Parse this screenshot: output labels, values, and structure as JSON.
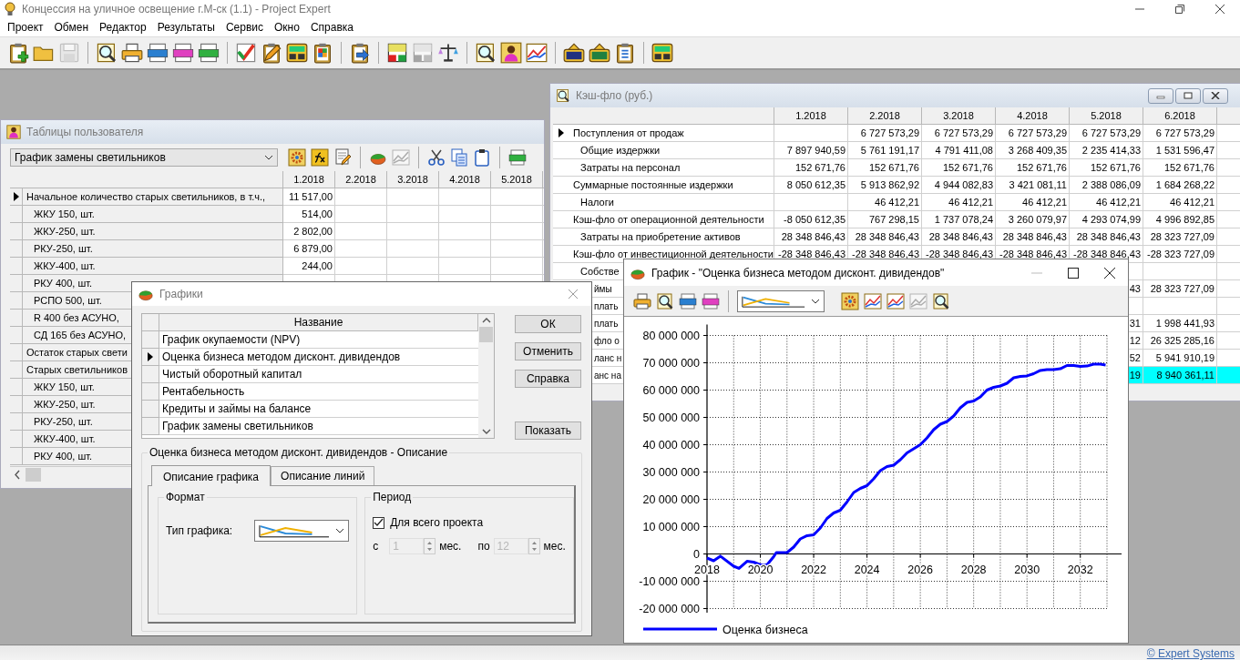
{
  "window": {
    "title": "Концессия на уличное освещение г.М-ск (1.1) - Project Expert"
  },
  "menu": [
    "Проект",
    "Обмен",
    "Редактор",
    "Результаты",
    "Сервис",
    "Окно",
    "Справка"
  ],
  "toolbar": [
    [
      {
        "disabled": false
      },
      {
        "disabled": false
      },
      {
        "disabled": true
      }
    ],
    [
      {
        "disabled": false
      },
      {
        "disabled": false
      },
      {
        "disabled": false
      },
      {
        "disabled": false
      },
      {
        "disabled": false
      }
    ],
    [
      {
        "disabled": false
      },
      {
        "disabled": false
      },
      {
        "disabled": false
      },
      {
        "disabled": false
      }
    ],
    [
      {
        "disabled": false
      }
    ],
    [
      {
        "disabled": false
      },
      {
        "disabled": true
      },
      {
        "disabled": false
      }
    ],
    [
      {
        "disabled": false
      },
      {
        "disabled": false
      },
      {
        "disabled": false
      }
    ],
    [
      {
        "disabled": false
      },
      {
        "disabled": false
      },
      {
        "disabled": false
      }
    ],
    [
      {
        "disabled": false
      }
    ]
  ],
  "user_tables": {
    "title": "Таблицы пользователя",
    "table_select": "График замены светильников",
    "toolbar": [
      [
        {
          "disabled": false
        },
        {
          "disabled": false
        },
        {
          "disabled": false
        }
      ],
      [
        {
          "disabled": false
        },
        {
          "disabled": true
        }
      ],
      [
        {
          "disabled": false
        },
        {
          "disabled": false
        },
        {
          "disabled": false
        }
      ],
      [
        {
          "disabled": false
        }
      ]
    ],
    "columns": [
      "1.2018",
      "2.2018",
      "3.2018",
      "4.2018",
      "5.2018"
    ],
    "rows": [
      {
        "label": "Начальное количество старых светильников, в т.ч.,",
        "selected": true,
        "values": [
          "11 517,00"
        ],
        "children": [
          {
            "label": "ЖКУ 150, шт.",
            "selected": false,
            "values": [
              "514,00"
            ]
          },
          {
            "label": "ЖКУ-250, шт.",
            "selected": false,
            "values": [
              "2 802,00"
            ]
          },
          {
            "label": "РКУ-250, шт.",
            "selected": false,
            "values": [
              "6 879,00"
            ]
          },
          {
            "label": "ЖКУ-400, шт.",
            "selected": false,
            "values": [
              "244,00"
            ]
          },
          {
            "label": "РКУ 400, шт.",
            "selected": false
          },
          {
            "label": "РСПО 500, шт.",
            "selected": false
          },
          {
            "label": "R 400 без АСУНО,",
            "selected": false
          },
          {
            "label": "СД 165 без АСУНО,",
            "selected": false
          }
        ]
      },
      {
        "label": "Остаток старых свети",
        "selected": false
      },
      {
        "label": "Старых светильников",
        "selected": false,
        "children": [
          {
            "label": "ЖКУ 150, шт.",
            "selected": false
          },
          {
            "label": "ЖКУ-250, шт.",
            "selected": false
          },
          {
            "label": "РКУ-250, шт.",
            "selected": false
          },
          {
            "label": "ЖКУ-400, шт.",
            "selected": false
          },
          {
            "label": "РКУ 400, шт.",
            "selected": false
          }
        ]
      }
    ]
  },
  "cash_flow": {
    "title": "Кэш-фло (руб.)",
    "columns": [
      "1.2018",
      "2.2018",
      "3.2018",
      "4.2018",
      "5.2018",
      "6.2018"
    ],
    "rows": [
      {
        "label": "Поступления от продаж",
        "selected": true,
        "values": [
          "6 727 573,29",
          "6 727 573,29",
          "6 727 573,29",
          "6 727 573,29",
          "6 727 573,29"
        ],
        "children": [
          {
            "label": "Общие издержки",
            "selected": false,
            "values": [
              "7 897 940,59",
              "5 761 191,17",
              "4 791 411,08",
              "3 268 409,35",
              "2 235 414,33",
              "1 531 596,47"
            ]
          },
          {
            "label": "Затраты на персонал",
            "selected": false,
            "values": [
              "152 671,76",
              "152 671,76",
              "152 671,76",
              "152 671,76",
              "152 671,76",
              "152 671,76"
            ]
          }
        ]
      },
      {
        "label": "Суммарные постоянные издержки",
        "selected": false,
        "values": [
          "8 050 612,35",
          "5 913 862,92",
          "4 944 082,83",
          "3 421 081,11",
          "2 388 086,09",
          "1 684 268,22"
        ],
        "children": [
          {
            "label": "Налоги",
            "selected": false,
            "values": [
              "46 412,21",
              "46 412,21",
              "46 412,21",
              "46 412,21",
              "46 412,21"
            ]
          }
        ]
      },
      {
        "label": "Кэш-фло от операционной деятельности",
        "selected": false,
        "values": [
          "-8 050 612,35",
          "767 298,15",
          "1 737 078,24",
          "3 260 079,97",
          "4 293 074,99",
          "4 996 892,85"
        ],
        "children": [
          {
            "label": "Затраты на приобретение активов",
            "selected": false,
            "values": [
              "28 348 846,43",
              "28 348 846,43",
              "28 348 846,43",
              "28 348 846,43",
              "28 348 846,43",
              "28 323 727,09"
            ]
          }
        ]
      },
      {
        "label": "Кэш-фло от инвестиционной деятельности",
        "selected": false,
        "values": [
          "-28 348 846,43",
          "-28 348 846,43",
          "-28 348 846,43",
          "-28 348 846,43",
          "-28 348 846,43",
          "-28 323 727,09"
        ],
        "children": [
          {
            "label": "Собстве",
            "selected": false
          }
        ]
      },
      {
        "label": "ймы",
        "kind": "tail",
        "values": [
          "43",
          "28 323 727,09"
        ]
      },
      {
        "label": "плать",
        "kind": "tail"
      },
      {
        "label": "плать",
        "kind": "tail",
        "values": [
          "31",
          "1 998 441,93"
        ]
      },
      {
        "label": "фло о",
        "kind": "tail",
        "values": [
          "12",
          "26 325 285,16"
        ]
      },
      {
        "label": "ланс н",
        "kind": "tail",
        "values": [
          "52",
          "5 941 910,19"
        ]
      },
      {
        "label": "анс на",
        "kind": "tail",
        "highlighted": true,
        "values": [
          "19",
          "8 940 361,11"
        ]
      }
    ]
  },
  "charts_dialog": {
    "title": "Графики",
    "column": "Название",
    "items": [
      {
        "label": "График окупаемости (NPV)",
        "selected": false
      },
      {
        "label": "Оценка бизнеса методом дисконт. дивидендов",
        "selected": true
      },
      {
        "label": "Чистый оборотный капитал",
        "selected": false
      },
      {
        "label": "Рентабельность",
        "selected": false
      },
      {
        "label": "Кредиты и займы на балансе",
        "selected": false
      },
      {
        "label": "График замены светильников",
        "selected": false
      }
    ],
    "buttons": [
      "ОК",
      "Отменить",
      "Справка",
      "Показать"
    ],
    "description": {
      "title": "Оценка бизнеса методом дисконт. дивидендов - Описание",
      "tabs": [
        {
          "label": "Описание графика",
          "selected": true
        },
        {
          "label": "Описание линий",
          "selected": false
        }
      ],
      "format": {
        "title": "Формат",
        "chart_type_label": "Тип графика:"
      },
      "period": {
        "title": "Период",
        "whole_project": {
          "label": "Для всего проекта",
          "checked": true
        },
        "from_label": "с",
        "from": {
          "value": "1",
          "disabled": true
        },
        "from_unit": "мес.",
        "to_label": "по",
        "to": {
          "value": "12",
          "disabled": true
        },
        "to_unit": "мес."
      }
    }
  },
  "chart_window": {
    "title": "График - \"Оценка бизнеса методом дисконт. дивидендов\"",
    "toolbar": [
      [
        {
          "disabled": false
        },
        {
          "disabled": false
        },
        {
          "disabled": false
        },
        {
          "disabled": false
        }
      ],
      [
        {
          "disabled": false
        },
        {
          "disabled": false
        },
        {
          "disabled": false
        },
        {
          "disabled": true
        },
        {
          "disabled": false
        }
      ]
    ],
    "chart_data": {
      "type": "line",
      "grid": true,
      "xlim": [
        2018,
        2033
      ],
      "ylim": [
        -21500000,
        84000000
      ],
      "xticks": [
        2018,
        2020,
        2022,
        2024,
        2026,
        2028,
        2030,
        2032
      ],
      "yticks": [
        {
          "value": 80000000,
          "label": "80 000 000"
        },
        {
          "value": 70000000,
          "label": "70 000 000"
        },
        {
          "value": 60000000,
          "label": "60 000 000"
        },
        {
          "value": 50000000,
          "label": "50 000 000"
        },
        {
          "value": 40000000,
          "label": "40 000 000"
        },
        {
          "value": 30000000,
          "label": "30 000 000"
        },
        {
          "value": 20000000,
          "label": "20 000 000"
        },
        {
          "value": 10000000,
          "label": "10 000 000"
        },
        {
          "value": 0,
          "label": "0"
        },
        {
          "value": -10000000,
          "label": "-10 000 000"
        },
        {
          "value": -20000000,
          "label": "-20 000 000"
        }
      ],
      "x": [
        2018,
        2018.25,
        2018.5,
        2019,
        2019.2,
        2019.5,
        2019.75,
        2020,
        2020.25,
        2020.5,
        2020.6,
        2021,
        2021.25,
        2021.5,
        2021.75,
        2022,
        2022.25,
        2022.5,
        2022.75,
        2023,
        2023.25,
        2023.5,
        2023.75,
        2024,
        2024.25,
        2024.5,
        2024.75,
        2025,
        2025.25,
        2025.5,
        2025.75,
        2026,
        2026.25,
        2026.5,
        2026.75,
        2027,
        2027.25,
        2027.5,
        2027.75,
        2028,
        2028.25,
        2028.5,
        2028.75,
        2029,
        2029.25,
        2029.5,
        2029.75,
        2030,
        2030.25,
        2030.5,
        2030.75,
        2031,
        2031.25,
        2031.5,
        2031.75,
        2032,
        2032.25,
        2032.5,
        2032.75,
        2032.95
      ],
      "series": [
        {
          "name": "Оценка бизнеса",
          "color": "#0000ff",
          "values": [
            -1500000,
            -2500000,
            -800000,
            -4500000,
            -5300000,
            -2700000,
            -3000000,
            -4000000,
            -4000000,
            -1000000,
            500000,
            500000,
            2500000,
            5500000,
            6700000,
            7000000,
            9500000,
            13000000,
            15000000,
            16000000,
            19000000,
            22500000,
            24000000,
            25000000,
            27500000,
            30500000,
            32000000,
            32500000,
            34500000,
            37000000,
            38500000,
            40000000,
            42500000,
            45500000,
            47500000,
            48500000,
            50500000,
            53500000,
            55500000,
            56000000,
            57500000,
            60000000,
            61000000,
            61500000,
            62500000,
            64500000,
            65000000,
            65200000,
            66000000,
            67200000,
            67500000,
            67500000,
            67800000,
            69000000,
            69000000,
            68700000,
            68800000,
            69500000,
            69500000,
            69200000
          ]
        }
      ]
    }
  },
  "status_bar": {
    "copyright": "© Expert Systems"
  }
}
